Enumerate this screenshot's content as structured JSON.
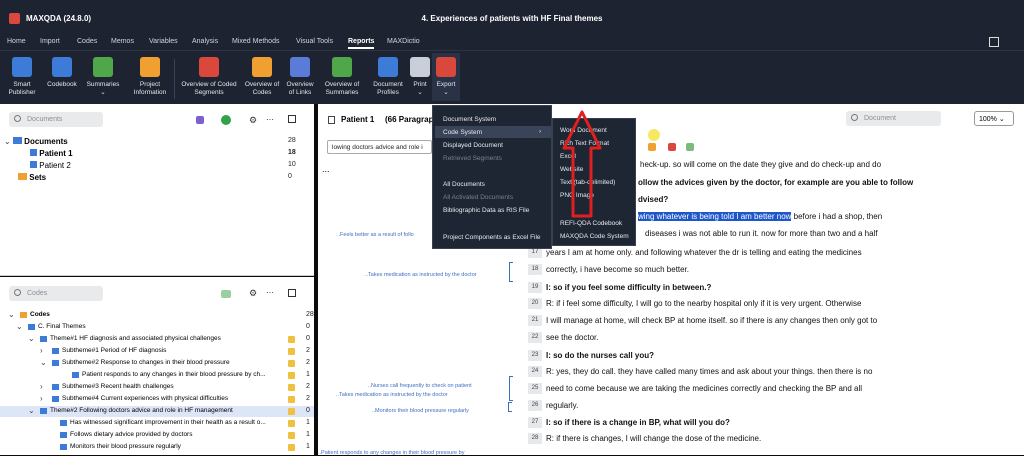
{
  "titlebar": {
    "app": "MAXQDA (24.8.0)",
    "document": "4. Experiences of patients with HF Final themes"
  },
  "menu": [
    "Home",
    "Import",
    "Codes",
    "Memos",
    "Variables",
    "Analysis",
    "Mixed Methods",
    "Visual Tools",
    "Reports",
    "MAXDictio"
  ],
  "ribbon": [
    {
      "l1": "Smart",
      "l2": "Publisher",
      "color": "#3d7bd9"
    },
    {
      "l1": "Codebook",
      "l2": "",
      "color": "#3d7bd9"
    },
    {
      "l1": "Summaries",
      "l2": "⌄",
      "color": "#4fa74a"
    },
    {
      "l1": "Project",
      "l2": "Information",
      "color": "#f0a030"
    },
    {
      "l1": "Overview of Coded",
      "l2": "Segments",
      "color": "#d9483b"
    },
    {
      "l1": "Overview of",
      "l2": "Codes",
      "color": "#f0a030"
    },
    {
      "l1": "Overview",
      "l2": "of Links",
      "color": "#5b7bd9"
    },
    {
      "l1": "Overview of",
      "l2": "Summaries",
      "color": "#4fa74a"
    },
    {
      "l1": "Document",
      "l2": "Profiles",
      "color": "#3d7bd9"
    },
    {
      "l1": "Print",
      "l2": "⌄",
      "color": "#c9ced8"
    },
    {
      "l1": "Export",
      "l2": "⌄",
      "color": "#d9483b"
    }
  ],
  "documents": {
    "search_placeholder": "Documents",
    "items": [
      {
        "label": "Documents",
        "count": "28"
      },
      {
        "label": "Patient 1",
        "count": "18"
      },
      {
        "label": "Patient 2",
        "count": "10"
      },
      {
        "label": "Sets",
        "count": "0"
      }
    ]
  },
  "codes": {
    "search_placeholder": "Codes",
    "items": [
      {
        "label": "Codes",
        "count": "28"
      },
      {
        "label": "C. Final Themes",
        "count": "0"
      },
      {
        "label": "Theme#1 HF diagnosis and associated physical challenges",
        "count": "0"
      },
      {
        "label": "Subtheme#1 Period of HF diagnosis",
        "count": "2"
      },
      {
        "label": "Subtheme#2 Response to changes in their blood pressure",
        "count": "2"
      },
      {
        "label": "Patient responds to any changes in their blood pressure by ch...",
        "count": "1"
      },
      {
        "label": "Subtheme#3 Recent health challenges",
        "count": "2"
      },
      {
        "label": "Subtheme#4 Current experiences with physical difficulties",
        "count": "2"
      },
      {
        "label": "Theme#2 Following doctors advice and role in HF management",
        "count": "0"
      },
      {
        "label": "Has witnessed significant improvement in their health as a result o...",
        "count": "1"
      },
      {
        "label": "Follows dietary advice provided by doctors",
        "count": "1"
      },
      {
        "label": "Monitors their blood pressure regularly",
        "count": "1"
      }
    ]
  },
  "browser": {
    "doc_title": "Patient 1",
    "paragraphs": "(66 Paragraph",
    "search_value": "lowing doctors advice and role i",
    "right_search": "Document",
    "zoom": "100%",
    "ellipsis": "..."
  },
  "lines": [
    {
      "num": "",
      "text": "heck-up. so will come on the date they give and do check-up and do",
      "bold": false
    },
    {
      "num": "",
      "text": "ollow the advices given by the doctor, for example are you able to follow",
      "bold": true
    },
    {
      "num": "",
      "text": "dvised?",
      "bold": true
    },
    {
      "num": "",
      "pre": "R: ",
      "hl": "wing whatever is being told I am better now",
      "text": " before i had a shop, then",
      "bold": false
    },
    {
      "num": "",
      "text": "diseases i was not able to run it. now for more than two and a half",
      "bold": false
    },
    {
      "num": "17",
      "text": "years I am at home only. and following whatever the dr is telling and eating the medicines",
      "bold": false
    },
    {
      "num": "18",
      "text": "correctly, i have become so much better.",
      "bold": false
    },
    {
      "num": "19",
      "text": "I: so if you feel some difficulty in between.?",
      "bold": true
    },
    {
      "num": "20",
      "text": "R: if i feel some difficulty, I will go to the nearby hospital only if it is very urgent. Otherwise",
      "bold": false
    },
    {
      "num": "21",
      "text": "I will manage at home, will check BP at home itself. so if there is any changes then only got to",
      "bold": false
    },
    {
      "num": "22",
      "text": "see the doctor.",
      "bold": false
    },
    {
      "num": "23",
      "text": "I: so do the nurses call you?",
      "bold": true
    },
    {
      "num": "24",
      "text": "R: yes, they do call. they have called many times and ask about your things. then there is no",
      "bold": false
    },
    {
      "num": "25",
      "text": "need to come because we are taking the medicines correctly and checking the BP and all",
      "bold": false
    },
    {
      "num": "26",
      "text": "regularly.",
      "bold": false
    },
    {
      "num": "27",
      "text": "I: so if there is a change in BP, what will you do?",
      "bold": true
    },
    {
      "num": "28",
      "text": "R: if there is changes, I will change the dose of the medicine.",
      "bold": false
    }
  ],
  "memos": [
    "..Feels better as a result of follo",
    "..Takes medication as instructed by the doctor",
    "..Nurses call frequently to check on patient",
    "..Takes medication as instructed by the doctor",
    "..Monitors their blood pressure regularly",
    "..Patient responds to any changes in their blood pressure by"
  ],
  "export_menu": {
    "col1": [
      {
        "label": "Document System",
        "enabled": true
      },
      {
        "label": "Code System",
        "enabled": true,
        "submenu": true
      },
      {
        "label": "Displayed Document",
        "enabled": true
      },
      {
        "label": "Retrieved Segments",
        "enabled": false
      },
      {
        "label": "All Documents",
        "enabled": true
      },
      {
        "label": "All Activated Documents",
        "enabled": false
      },
      {
        "label": "Bibliographic Data as RIS File",
        "enabled": true
      },
      {
        "label": "Project Components as Excel File",
        "enabled": true
      }
    ],
    "col2": [
      "Word Document",
      "Rich Text Format",
      "Excel",
      "Website",
      "Text (tab-delimited)",
      "PNG Image",
      "REFI-QDA Codebook",
      "MAXQDA Code System"
    ]
  }
}
